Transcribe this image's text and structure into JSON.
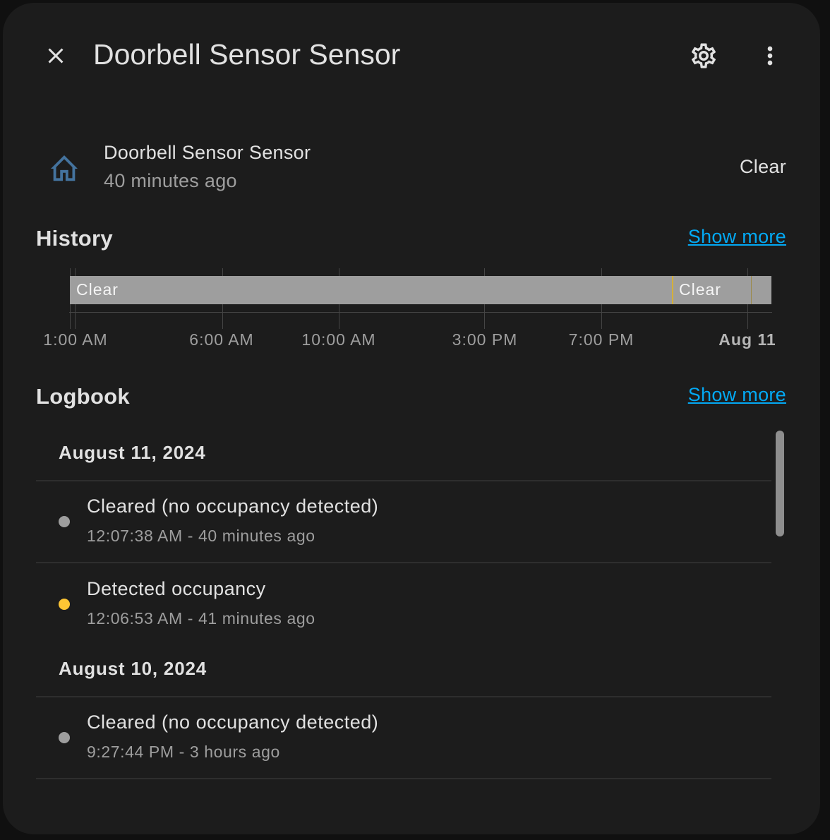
{
  "header": {
    "title": "Doorbell Sensor Sensor",
    "close_icon": "close-icon",
    "settings_icon": "gear-icon",
    "more_icon": "dots-vertical-icon"
  },
  "entity": {
    "icon": "home-outline-icon",
    "name": "Doorbell Sensor Sensor",
    "last_changed": "40 minutes ago",
    "state": "Clear"
  },
  "history": {
    "title": "History",
    "show_more": "Show more",
    "bars": [
      {
        "label": "Clear"
      },
      {
        "label": "Clear"
      }
    ],
    "tick_labels": [
      "1:00 AM",
      "6:00 AM",
      "10:00 AM",
      "3:00 PM",
      "7:00 PM",
      "Aug 11"
    ]
  },
  "logbook": {
    "title": "Logbook",
    "show_more": "Show more",
    "groups": [
      {
        "date": "August 11, 2024",
        "entries": [
          {
            "message": "Cleared (no occupancy detected)",
            "time": "12:07:38 AM - 40 minutes ago",
            "dot_color": "#9e9e9e"
          },
          {
            "message": "Detected occupancy",
            "time": "12:06:53 AM - 41 minutes ago",
            "dot_color": "#fdc534"
          }
        ]
      },
      {
        "date": "August 10, 2024",
        "entries": [
          {
            "message": "Cleared (no occupancy detected)",
            "time": "9:27:44 PM - 3 hours ago",
            "dot_color": "#9e9e9e"
          }
        ]
      }
    ]
  },
  "colors": {
    "background": "#1c1c1c",
    "accent_link": "#03a9f4",
    "bar_clear": "#9e9e9e",
    "detected_marker": "#fdc534",
    "entity_icon": "#44739e"
  }
}
